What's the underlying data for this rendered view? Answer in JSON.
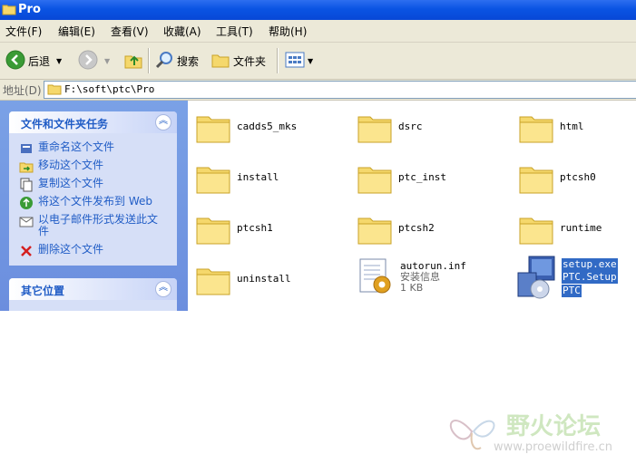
{
  "window": {
    "title": "Pro"
  },
  "menu": [
    "文件(F)",
    "编辑(E)",
    "查看(V)",
    "收藏(A)",
    "工具(T)",
    "帮助(H)"
  ],
  "toolbar": {
    "back": "后退",
    "search": "搜索",
    "folders": "文件夹"
  },
  "address": {
    "label": "地址(D)",
    "path": "F:\\soft\\ptc\\Pro"
  },
  "file_tasks": {
    "title": "文件和文件夹任务",
    "items": [
      "重命名这个文件",
      "移动这个文件",
      "复制这个文件",
      "将这个文件发布到 Web",
      "以电子邮件形式发送此文件",
      "删除这个文件"
    ]
  },
  "other_places": {
    "title": "其它位置"
  },
  "files": [
    {
      "name": "cadds5_mks"
    },
    {
      "name": "dsrc"
    },
    {
      "name": "html"
    },
    {
      "name": "install"
    },
    {
      "name": "ptc_inst"
    },
    {
      "name": "ptcsh0"
    },
    {
      "name": "ptcsh1"
    },
    {
      "name": "ptcsh2"
    },
    {
      "name": "runtime"
    },
    {
      "name": "uninstall"
    },
    {
      "name": "autorun.inf",
      "type": "安装信息",
      "size": "1 KB"
    },
    {
      "name": "setup.exe",
      "desc": "PTC.Setup",
      "company": "PTC"
    }
  ],
  "watermark": {
    "title": "野火论坛",
    "url": "www.proewildfire.cn"
  },
  "colors": {
    "title_bar": "#0a54e3",
    "sidebar_link": "#215dc6",
    "selection": "#316ac5",
    "folder": "#f5d86c"
  }
}
